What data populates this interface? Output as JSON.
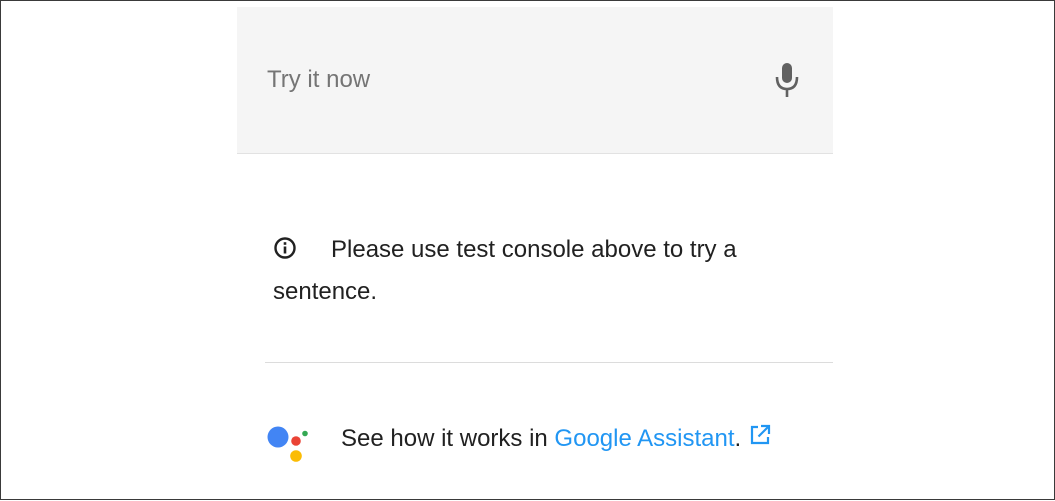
{
  "try_bar": {
    "placeholder": "Try it now",
    "icon": "microphone-icon"
  },
  "info": {
    "icon": "info-icon",
    "message": "Please use test console above to try a sentence."
  },
  "assistant": {
    "prefix": "See how it works in ",
    "link_label": "Google Assistant",
    "suffix": ".",
    "link_icon": "external-link-icon",
    "logo_colors": [
      "#4285f4",
      "#ea4335",
      "#fbbc04",
      "#34a853"
    ]
  },
  "colors": {
    "link": "#2196f3",
    "text": "#212121",
    "placeholder": "#757575",
    "bar_background": "#f5f5f5"
  }
}
